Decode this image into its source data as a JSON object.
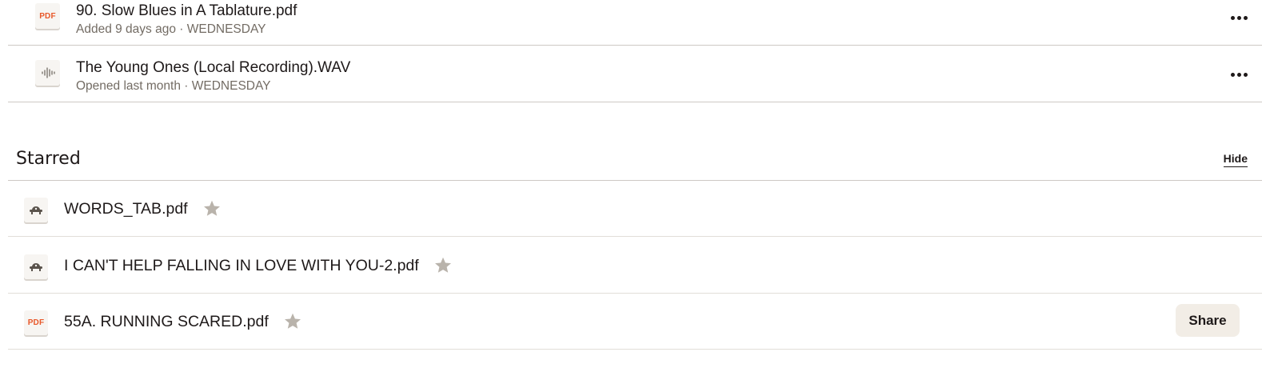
{
  "recent": [
    {
      "icon": "pdf-file-icon",
      "icon_label": "PDF",
      "title": "90. Slow Blues in A Tablature.pdf",
      "meta": "Added 9 days ago · WEDNESDAY"
    },
    {
      "icon": "audio-file-icon",
      "icon_label": "",
      "title": "The Young Ones (Local Recording).WAV",
      "meta": "Opened last month · WEDNESDAY"
    }
  ],
  "starred": {
    "title": "Starred",
    "hide_label": "Hide",
    "items": [
      {
        "icon": "tabs-app-icon",
        "icon_label": "",
        "name": "WORDS_TAB.pdf"
      },
      {
        "icon": "tabs-app-icon",
        "icon_label": "",
        "name": "I CAN'T HELP FALLING IN LOVE WITH YOU-2.pdf"
      },
      {
        "icon": "pdf-file-icon",
        "icon_label": "PDF",
        "name": "55A. RUNNING SCARED.pdf",
        "action": "Share"
      }
    ]
  },
  "colors": {
    "pdf_accent": "#e8582a",
    "star": "#b9b3ab",
    "text": "#1e1919",
    "muted": "#736c64",
    "share_bg": "#f2ede6"
  }
}
